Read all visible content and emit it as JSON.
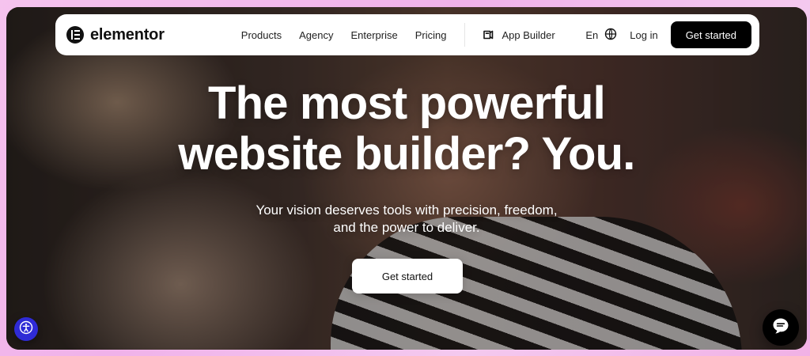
{
  "nav": {
    "brand": "elementor",
    "links": [
      "Products",
      "Agency",
      "Enterprise",
      "Pricing"
    ],
    "app_builder": "App Builder",
    "language": "En",
    "login": "Log in",
    "cta": "Get started"
  },
  "hero": {
    "headline_lines": [
      "The most powerful",
      "website builder? You."
    ],
    "subhead_lines": [
      "Your vision deserves tools with precision, freedom,",
      "and the power to deliver."
    ],
    "cta": "Get started"
  },
  "icons": {
    "brand_mark": "elementor-logo-icon",
    "app_builder": "app-builder-icon",
    "language": "globe-icon",
    "accessibility": "accessibility-icon",
    "chat": "chat-icon"
  },
  "colors": {
    "frame": "#f2b7e7",
    "nav_bg": "#ffffff",
    "primary_button": "#000000",
    "primary_button_text": "#ffffff",
    "hero_text": "#ffffff",
    "accessibility_button": "#2f2bd6",
    "chat_button": "#000000"
  }
}
